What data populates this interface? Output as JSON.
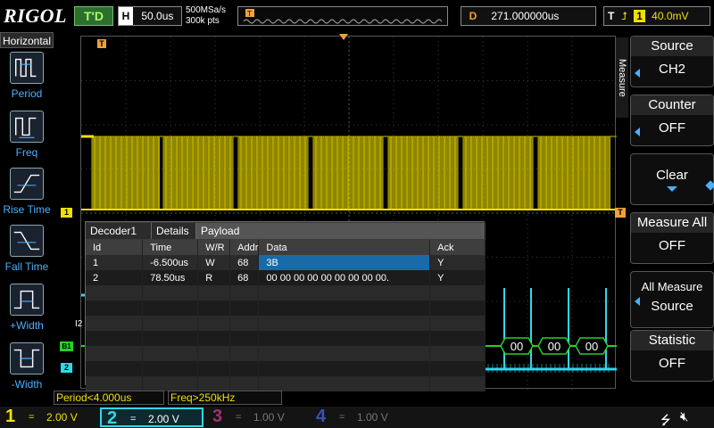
{
  "top": {
    "logo": "RIGOL",
    "trigger_status": "T'D",
    "timebase_key": "H",
    "timebase_value": "50.0us",
    "sample_rate": "500MSa/s",
    "memory_depth": "300k pts",
    "delay_key": "D",
    "delay_value": "271.000000us",
    "trigger_key": "T",
    "trigger_channel": "1",
    "trigger_level": "40.0mV"
  },
  "left_panel": {
    "title": "Horizontal",
    "items": [
      {
        "label": "Period",
        "icon": "period-icon"
      },
      {
        "label": "Freq",
        "icon": "freq-icon"
      },
      {
        "label": "Rise Time",
        "icon": "rise-time-icon"
      },
      {
        "label": "Fall Time",
        "icon": "fall-time-icon"
      },
      {
        "label": "+Width",
        "icon": "pos-width-icon"
      },
      {
        "label": "-Width",
        "icon": "neg-width-icon"
      }
    ]
  },
  "right_panel": {
    "menu_title": "Measure",
    "source": {
      "label": "Source",
      "value": "CH2"
    },
    "counter": {
      "label": "Counter",
      "value": "OFF"
    },
    "clear": {
      "label": "Clear"
    },
    "measure_all": {
      "label": "Measure All",
      "value": "OFF"
    },
    "all_measure_source": {
      "line1": "All Measure",
      "line2": "Source"
    },
    "statistic": {
      "label": "Statistic",
      "value": "OFF"
    }
  },
  "markers": {
    "trigger_marker": "T",
    "ch1_marker": "1",
    "ch2_marker": "2",
    "bus_marker": "B1",
    "ch2_side_label": "I2"
  },
  "bus_decode_values": [
    "00",
    "00",
    "00"
  ],
  "decoder": {
    "tabs": [
      "Decoder1",
      "Details",
      "Payload"
    ],
    "columns": [
      "Id",
      "Time",
      "W/R",
      "Addr",
      "Data",
      "Ack"
    ],
    "rows": [
      {
        "id": "1",
        "time": "-6.500us",
        "wr": "W",
        "addr": "68",
        "data": "3B",
        "ack": "Y"
      },
      {
        "id": "2",
        "time": "78.50us",
        "wr": "R",
        "addr": "68",
        "data": "00 00 00 00 00 00 00 00 00.",
        "ack": "Y"
      }
    ]
  },
  "readouts": {
    "period": "Period<4.000us",
    "freq": "Freq>250kHz"
  },
  "channels": [
    {
      "num": "1",
      "coupling": "=",
      "scale": "2.00 V",
      "color": "#f0e000"
    },
    {
      "num": "2",
      "coupling": "=",
      "scale": "2.00 V",
      "color": "#2fd8e8"
    },
    {
      "num": "3",
      "coupling": "=",
      "scale": "1.00 V",
      "color": "#a0307a"
    },
    {
      "num": "4",
      "coupling": "=",
      "scale": "1.00 V",
      "color": "#3a50c0"
    }
  ],
  "colors": {
    "ch1": "#f0e000",
    "ch2": "#2fd8e8",
    "bus": "#28d028",
    "accent": "#4ab0ff",
    "selection": "#1a6aa8"
  }
}
